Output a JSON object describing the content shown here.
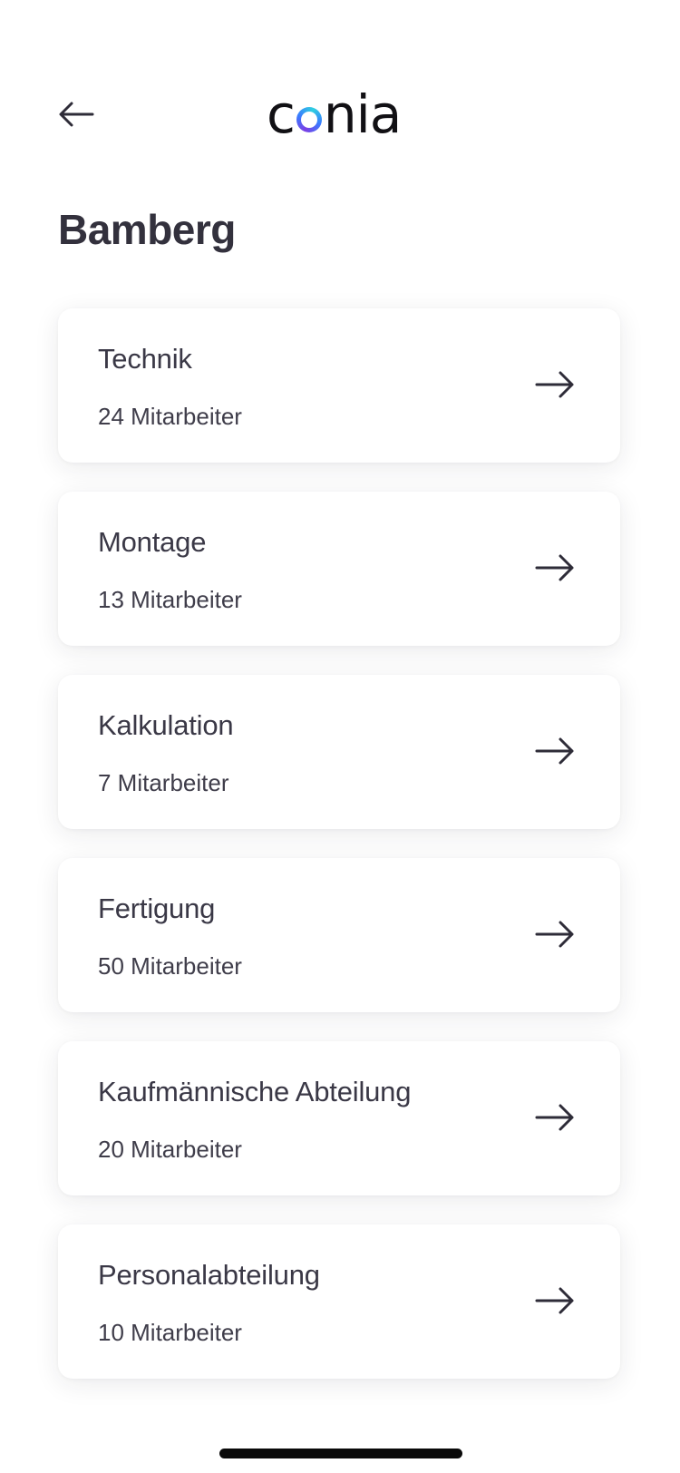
{
  "header": {
    "back_icon": "arrow-left-icon",
    "logo": {
      "prefix": "c",
      "middle": "o",
      "suffix": "nia",
      "ring_colors": [
        "#7b3fe4",
        "#3a7bff",
        "#2ecfe0"
      ]
    }
  },
  "page": {
    "title": "Bamberg"
  },
  "departments": [
    {
      "name": "Technik",
      "count": "24 Mitarbeiter"
    },
    {
      "name": "Montage",
      "count": "13 Mitarbeiter"
    },
    {
      "name": "Kalkulation",
      "count": "7 Mitarbeiter"
    },
    {
      "name": "Fertigung",
      "count": "50 Mitarbeiter"
    },
    {
      "name": "Kaufmännische Abteilung",
      "count": "20 Mitarbeiter"
    },
    {
      "name": "Personalabteilung",
      "count": "10 Mitarbeiter"
    }
  ],
  "card_icon": "arrow-right-icon",
  "colors": {
    "text": "#33313d",
    "background": "#ffffff",
    "home_indicator": "#0a0a0a"
  }
}
